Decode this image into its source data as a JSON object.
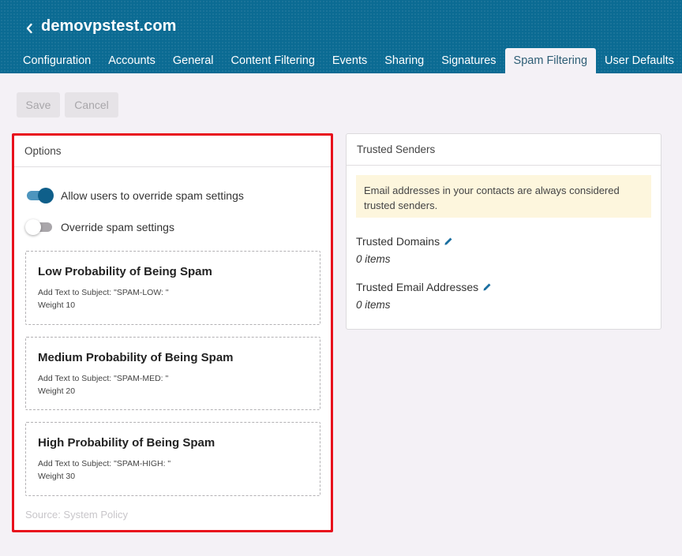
{
  "header": {
    "title": "demovpstest.com",
    "back_icon": "chevron-left-icon"
  },
  "tabs": [
    {
      "label": "Configuration",
      "active": false
    },
    {
      "label": "Accounts",
      "active": false
    },
    {
      "label": "General",
      "active": false
    },
    {
      "label": "Content Filtering",
      "active": false
    },
    {
      "label": "Events",
      "active": false
    },
    {
      "label": "Sharing",
      "active": false
    },
    {
      "label": "Signatures",
      "active": false
    },
    {
      "label": "Spam Filtering",
      "active": true
    },
    {
      "label": "User Defaults",
      "active": false
    }
  ],
  "toolbar": {
    "save_label": "Save",
    "cancel_label": "Cancel"
  },
  "options": {
    "title": "Options",
    "toggles": [
      {
        "label": "Allow users to override spam settings",
        "on": true
      },
      {
        "label": "Override spam settings",
        "on": false
      }
    ],
    "levels": [
      {
        "title": "Low Probability of Being Spam",
        "subject": "Add Text to Subject: \"SPAM-LOW: \"",
        "weight": "Weight 10"
      },
      {
        "title": "Medium Probability of Being Spam",
        "subject": "Add Text to Subject: \"SPAM-MED: \"",
        "weight": "Weight 20"
      },
      {
        "title": "High Probability of Being Spam",
        "subject": "Add Text to Subject: \"SPAM-HIGH: \"",
        "weight": "Weight 30"
      }
    ],
    "source": "Source: System Policy"
  },
  "trusted": {
    "title": "Trusted Senders",
    "notice": "Email addresses in your contacts are always considered trusted senders.",
    "domains_label": "Trusted Domains",
    "domains_value": "0 items",
    "emails_label": "Trusted Email Addresses",
    "emails_value": "0 items",
    "edit_icon": "pencil-icon"
  },
  "colors": {
    "header_bg": "#0b6b93",
    "toggle_on": "#0f5f8a",
    "highlight": "#e8101c",
    "notice_bg": "#fdf6dd"
  }
}
